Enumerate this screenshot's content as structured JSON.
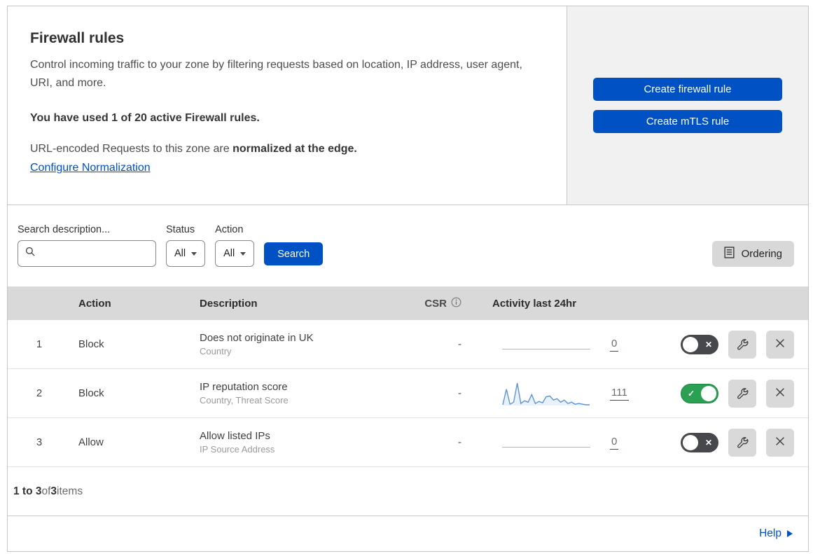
{
  "header": {
    "title": "Firewall rules",
    "description": "Control incoming traffic to your zone by filtering requests based on location, IP address, user agent, URI, and more.",
    "usage": "You have used 1 of 20 active Firewall rules.",
    "normalization_prefix": "URL-encoded Requests to this zone are ",
    "normalization_bold": "normalized at the edge.",
    "configure_link": "Configure Normalization",
    "create_firewall_button": "Create firewall rule",
    "create_mtls_button": "Create mTLS rule"
  },
  "filters": {
    "search_label": "Search description...",
    "search_value": "",
    "status_label": "Status",
    "status_value": "All",
    "action_label": "Action",
    "action_value": "All",
    "search_button": "Search",
    "ordering_button": "Ordering"
  },
  "table": {
    "columns": {
      "action": "Action",
      "description": "Description",
      "csr": "CSR",
      "activity": "Activity last 24hr"
    },
    "rows": [
      {
        "priority": "1",
        "action": "Block",
        "description": "Does not originate in UK",
        "criteria": "Country",
        "csr": "-",
        "activity_count": "0",
        "enabled": false
      },
      {
        "priority": "2",
        "action": "Block",
        "description": "IP reputation score",
        "criteria": "Country, Threat Score",
        "csr": "-",
        "activity_count": "111",
        "enabled": true
      },
      {
        "priority": "3",
        "action": "Allow",
        "description": "Allow listed IPs",
        "criteria": "IP Source Address",
        "csr": "-",
        "activity_count": "0",
        "enabled": false
      }
    ]
  },
  "chart_data": {
    "type": "area",
    "title": "Activity last 24hr",
    "series": [
      {
        "name": "rule-1-activity",
        "values": [
          0
        ],
        "total": 0
      },
      {
        "name": "rule-2-activity",
        "values": [
          1,
          24,
          2,
          5,
          33,
          3,
          7,
          5,
          16,
          3,
          6,
          4,
          13,
          14,
          8,
          10,
          5,
          8,
          3,
          5,
          2,
          3,
          2,
          1,
          1
        ],
        "total": 111
      },
      {
        "name": "rule-3-activity",
        "values": [
          0
        ],
        "total": 0
      }
    ]
  },
  "footer": {
    "range": "1 to 3",
    "of_text": " of ",
    "total": "3",
    "items_text": " items"
  },
  "help": {
    "label": "Help"
  },
  "colors": {
    "primary_blue": "#0051c3",
    "link_blue": "#0051c3",
    "toggle_on_green": "#2aa052",
    "toggle_off_gray": "#46484b",
    "sparkline_line": "#5b93d6",
    "sparkline_fill": "#e9f1fa",
    "table_header_gray": "#d9d9d9",
    "panel_gray": "#f1f1f1"
  }
}
